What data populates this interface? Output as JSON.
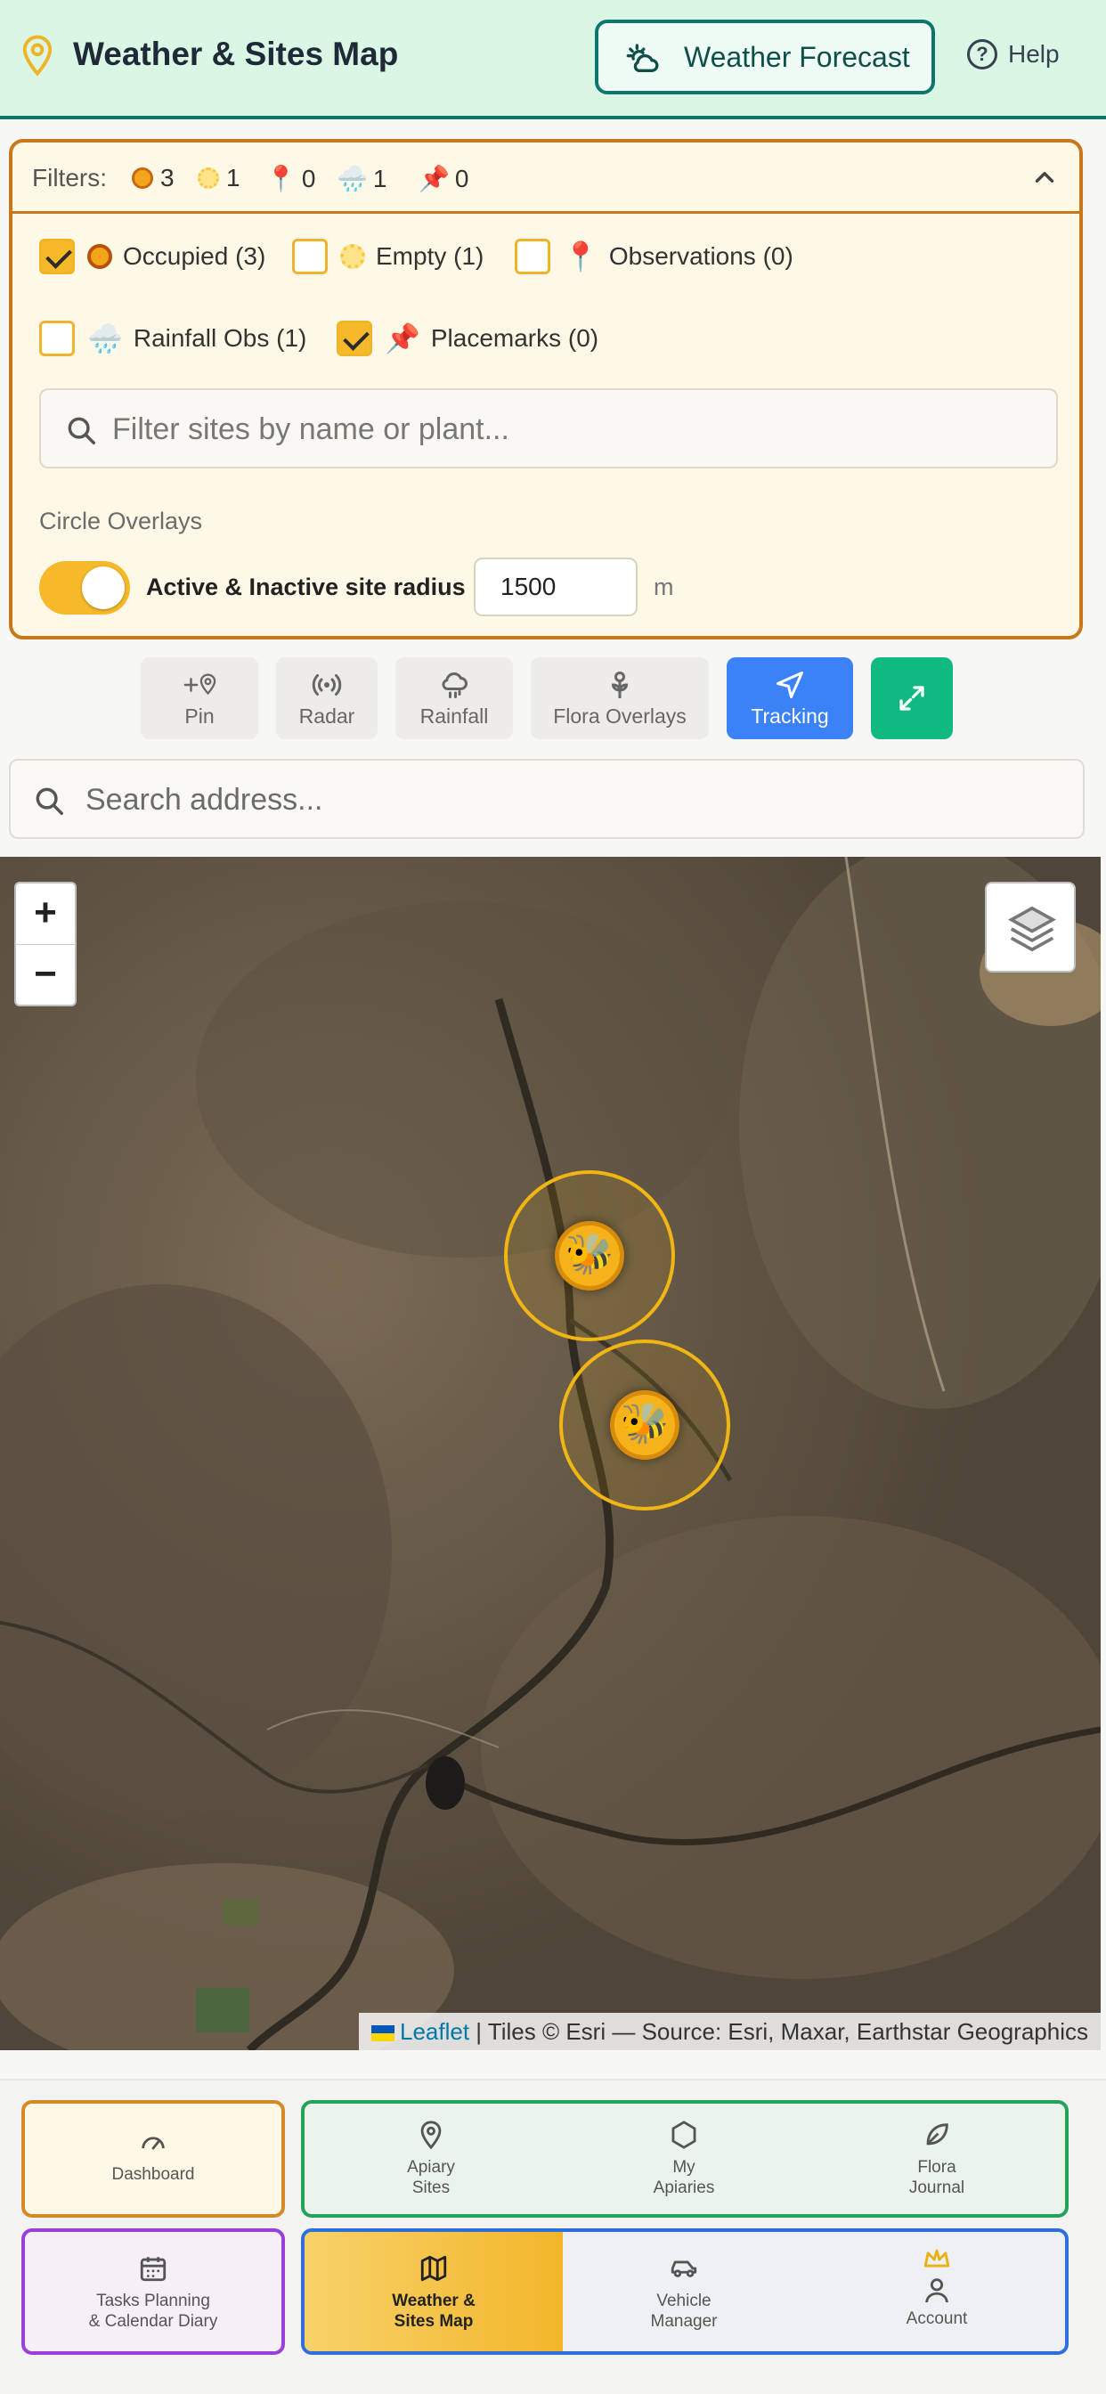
{
  "header": {
    "title": "Weather & Sites Map",
    "forecast_button": "Weather Forecast",
    "help_label": "Help",
    "accent": "#0f766e"
  },
  "filters": {
    "label": "Filters:",
    "summary": [
      {
        "icon": "occupied-dot-icon",
        "count": "3"
      },
      {
        "icon": "empty-dot-icon",
        "count": "1"
      },
      {
        "icon": "pin-emoji-icon",
        "glyph": "📍",
        "count": "0"
      },
      {
        "icon": "rain-cloud-icon",
        "glyph": "🌧️",
        "count": "1"
      },
      {
        "icon": "pushpin-icon",
        "glyph": "📌",
        "count": "0"
      }
    ],
    "options": [
      {
        "label": "Occupied (3)",
        "checked": true
      },
      {
        "label": "Empty (1)",
        "checked": false
      },
      {
        "label": "Observations (0)",
        "checked": false,
        "glyph": "📍"
      },
      {
        "label": "Rainfall Obs (1)",
        "checked": false,
        "glyph": "🌧️"
      },
      {
        "label": "Placemarks (0)",
        "checked": true,
        "glyph": "📌"
      }
    ],
    "search_placeholder": "Filter sites by name or plant...",
    "circle_overlays_label": "Circle Overlays",
    "radius_toggle_label": "Active & Inactive site radius",
    "radius_toggle_on": true,
    "radius_value": "1500",
    "radius_unit": "m"
  },
  "toolbar": {
    "pin": "Pin",
    "radar": "Radar",
    "rainfall": "Rainfall",
    "flora": "Flora Overlays",
    "tracking": "Tracking",
    "tracking_color": "#3b82f6",
    "expand_color": "#10b981"
  },
  "address_search": {
    "placeholder": "Search address..."
  },
  "map": {
    "zoom_in": "+",
    "zoom_out": "−",
    "site_marker_glyph": "🐝",
    "attribution_link": "Leaflet",
    "attribution_text": "| Tiles © Esri — Source: Esri, Maxar, Earthstar Geographics"
  },
  "nav": {
    "dashboard": "Dashboard",
    "apiary_sites": [
      "Apiary",
      "Sites"
    ],
    "my_apiaries": [
      "My",
      "Apiaries"
    ],
    "flora_journal": [
      "Flora",
      "Journal"
    ],
    "tasks": [
      "Tasks Planning",
      "& Calendar Diary"
    ],
    "weather_map": [
      "Weather &",
      "Sites Map"
    ],
    "vehicle": [
      "Vehicle",
      "Manager"
    ],
    "account": "Account"
  }
}
